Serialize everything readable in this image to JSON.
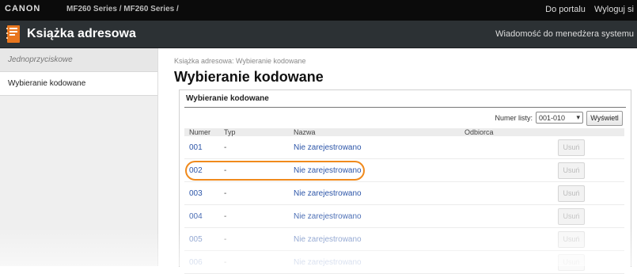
{
  "topbar": {
    "brand": "CANON",
    "model": "MF260 Series / MF260 Series /",
    "links": [
      "Do portalu",
      "Wyloguj si"
    ]
  },
  "header": {
    "title": "Książka adresowa",
    "message_link": "Wiadomość do menedżera systemu"
  },
  "sidebar": {
    "items": [
      {
        "label": "Jednoprzyciskowe"
      },
      {
        "label": "Wybieranie kodowane"
      }
    ]
  },
  "main": {
    "breadcrumb": "Książka adresowa: Wybieranie kodowane",
    "title": "Wybieranie kodowane",
    "section_title": "Wybieranie kodowane",
    "list_label": "Numer listy:",
    "list_value": "001-010",
    "show_button": "Wyświetl",
    "columns": [
      "Numer",
      "Typ",
      "Nazwa",
      "Odbiorca"
    ],
    "rows": [
      {
        "num": "001",
        "type": "-",
        "name": "Nie zarejestrowano",
        "delete": "Usuń"
      },
      {
        "num": "002",
        "type": "-",
        "name": "Nie zarejestrowano",
        "delete": "Usuń"
      },
      {
        "num": "003",
        "type": "-",
        "name": "Nie zarejestrowano",
        "delete": "Usuń"
      },
      {
        "num": "004",
        "type": "-",
        "name": "Nie zarejestrowano",
        "delete": "Usuń"
      },
      {
        "num": "005",
        "type": "-",
        "name": "Nie zarejestrowano",
        "delete": "Usuń"
      },
      {
        "num": "006",
        "type": "-",
        "name": "Nie zarejestrowano",
        "delete": "Usuń"
      }
    ]
  },
  "colors": {
    "header_bg": "#2c3134",
    "link": "#2c55a8",
    "highlight": "#f08a1c",
    "icon_orange": "#e8761e"
  }
}
